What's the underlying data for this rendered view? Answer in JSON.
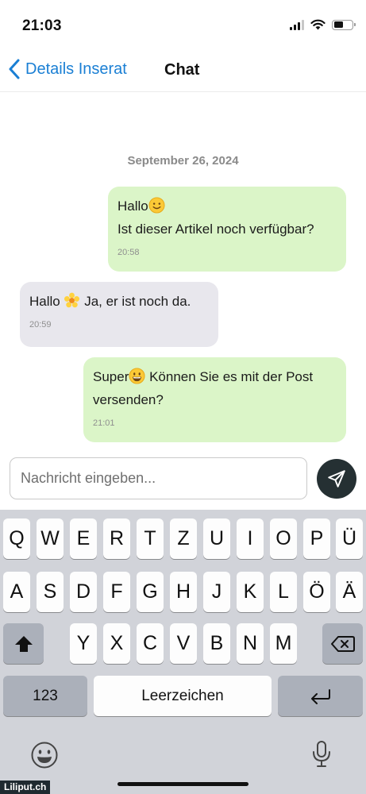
{
  "status_bar": {
    "time": "21:03"
  },
  "nav": {
    "back_label": "Details Inserat",
    "title": "Chat"
  },
  "chat": {
    "date": "September 26, 2024",
    "messages": [
      {
        "direction": "outgoing",
        "line1": "Hallo",
        "line2": "Ist dieser Artikel noch verfügbar?",
        "time": "20:58",
        "emoji": "slightly-smiling-face-icon"
      },
      {
        "direction": "incoming",
        "before": "Hallo ",
        "after": " Ja, er ist noch da.",
        "time": "20:59",
        "emoji": "blossom-icon"
      },
      {
        "direction": "outgoing",
        "before": "Super",
        "after": " Können Sie es mit der Post",
        "line2": "versenden?",
        "time": "21:01",
        "emoji": "grinning-face-icon"
      }
    ]
  },
  "composer": {
    "placeholder": "Nachricht eingeben..."
  },
  "keyboard": {
    "row1": [
      "Q",
      "W",
      "E",
      "R",
      "T",
      "Z",
      "U",
      "I",
      "O",
      "P",
      "Ü"
    ],
    "row2": [
      "A",
      "S",
      "D",
      "F",
      "G",
      "H",
      "J",
      "K",
      "L",
      "Ö",
      "Ä"
    ],
    "row3": [
      "Y",
      "X",
      "C",
      "V",
      "B",
      "N",
      "M"
    ],
    "numbers_label": "123",
    "space_label": "Leerzeichen"
  },
  "watermark": "Liliput.ch",
  "colors": {
    "outgoing_bubble": "#dbf5c8",
    "incoming_bubble": "#e8e7ed",
    "accent_link": "#1a7fd4",
    "send_button": "#253033",
    "keyboard_bg": "#d1d3d9"
  }
}
